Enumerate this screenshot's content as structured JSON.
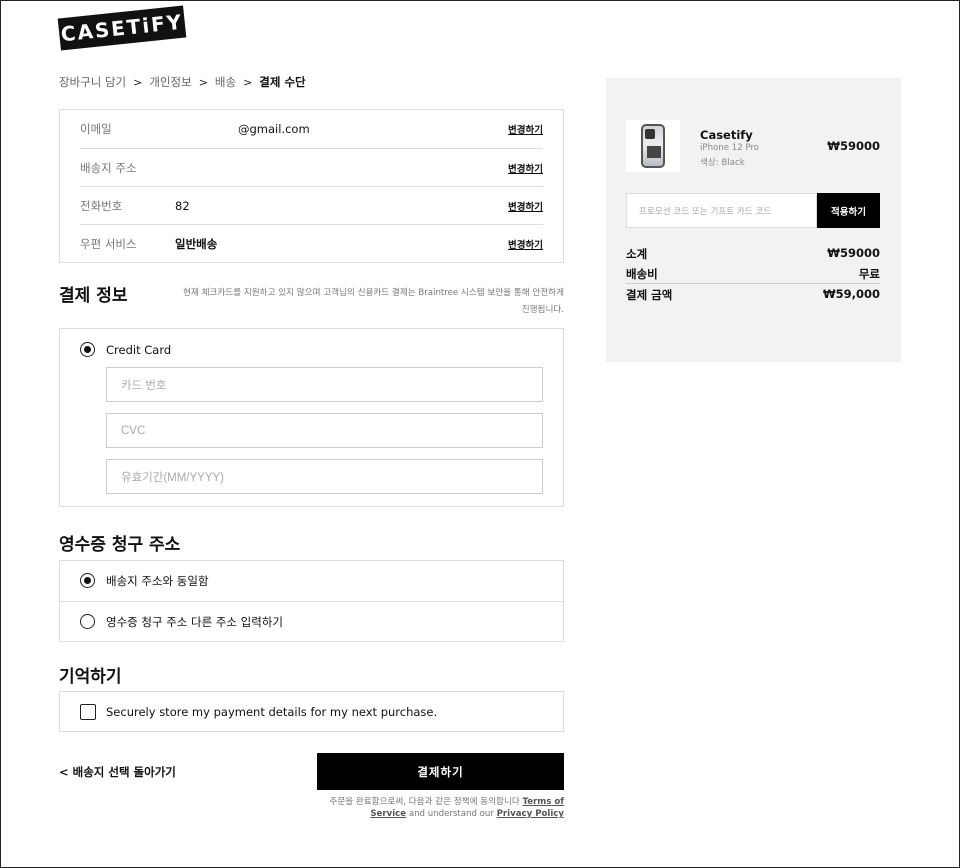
{
  "brand": {
    "logo_text": "CASETiFY"
  },
  "breadcrumb": {
    "items": [
      "장바구니 담기",
      "개인정보",
      "배송"
    ],
    "separator": ">",
    "current": "결제 수단"
  },
  "info": {
    "change_label": "변경하기",
    "rows": [
      {
        "label": "이메일",
        "value": "@gmail.com"
      },
      {
        "label": "배송지 주소",
        "value": ""
      },
      {
        "label": "전화번호",
        "value": "82"
      },
      {
        "label": "우편 서비스",
        "value": "일반배송"
      }
    ]
  },
  "payment": {
    "title": "결제 정보",
    "note": "현재 체크카드를 지원하고 있지 않으며 고객님의 신용카드 결제는 Braintree 시스템 보안을 통해 안전하게 진행됩니다.",
    "method_label": "Credit Card",
    "card_number_placeholder": "카드 번호",
    "cvc_placeholder": "CVC",
    "expiry_placeholder": "유효기간(MM/YYYY)"
  },
  "billing": {
    "title": "영수증 청구 주소",
    "options": [
      "배송지 주소와 동일함",
      "영수증 청구 주소 다른 주소 입력하기"
    ]
  },
  "remember": {
    "title": "기억하기",
    "checkbox_label": "Securely store my payment details for my next purchase."
  },
  "actions": {
    "back_label": "< 배송지 선택 돌아가기",
    "pay_label": "결제하기",
    "terms_prefix": "주문을 완료함으로써, 다음과 같은 정책에 동의합니다",
    "terms_link": "Terms of Service",
    "terms_mid": "and understand our",
    "privacy_link": "Privacy Policy"
  },
  "summary": {
    "product": {
      "name": "Casetify",
      "model": "iPhone 12 Pro",
      "color": "색상: Black",
      "price": "₩59000"
    },
    "promo_placeholder": "프로모션 코드 또는 기프트 카드 코드",
    "promo_button": "적용하기",
    "subtotal_label": "소계",
    "subtotal_value": "₩59000",
    "shipping_label": "배송비",
    "shipping_value": "무료",
    "total_label": "결제 금액",
    "total_value": "₩59,000"
  }
}
